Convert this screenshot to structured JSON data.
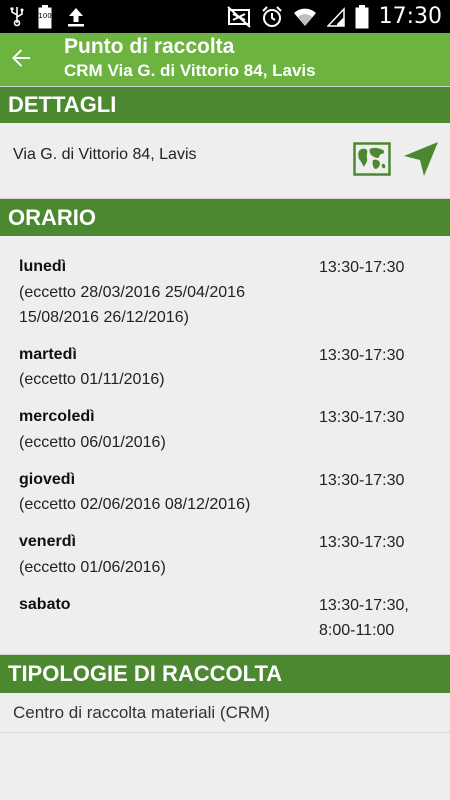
{
  "status_bar": {
    "time": "17:30",
    "battery_small": "100",
    "icons": [
      "usb-icon",
      "battery-full-icon",
      "upload-icon",
      "mute-icon",
      "alarm-icon",
      "wifi-icon",
      "signal-icon",
      "battery-icon"
    ]
  },
  "app_bar": {
    "title": "Punto di raccolta",
    "subtitle": "CRM Via G. di Vittorio 84, Lavis",
    "back_icon": "arrow-back-icon"
  },
  "details": {
    "header": "DETTAGLI",
    "address": "Via G. di Vittorio 84, Lavis",
    "map_icon": "map-icon",
    "navigate_icon": "navigation-arrow-icon"
  },
  "schedule": {
    "header": "ORARIO",
    "days": [
      {
        "day": "lunedì",
        "exceptions": "(eccetto 28/03/2016 25/04/2016 15/08/2016 26/12/2016)",
        "hours": "13:30-17:30"
      },
      {
        "day": "martedì",
        "exceptions": "(eccetto 01/11/2016)",
        "hours": "13:30-17:30"
      },
      {
        "day": "mercoledì",
        "exceptions": "(eccetto 06/01/2016)",
        "hours": "13:30-17:30"
      },
      {
        "day": "giovedì",
        "exceptions": "(eccetto 02/06/2016 08/12/2016)",
        "hours": "13:30-17:30"
      },
      {
        "day": "venerdì",
        "exceptions": "(eccetto 01/06/2016)",
        "hours": "13:30-17:30"
      },
      {
        "day": "sabato",
        "exceptions": "",
        "hours": "13:30-17:30, 8:00-11:00"
      }
    ]
  },
  "types": {
    "header": "TIPOLOGIE DI RACCOLTA",
    "items": [
      "Centro di raccolta materiali (CRM)"
    ]
  },
  "colors": {
    "app_bar": "#6cb33f",
    "section_header": "#4b8830",
    "background": "#eeeeee"
  }
}
